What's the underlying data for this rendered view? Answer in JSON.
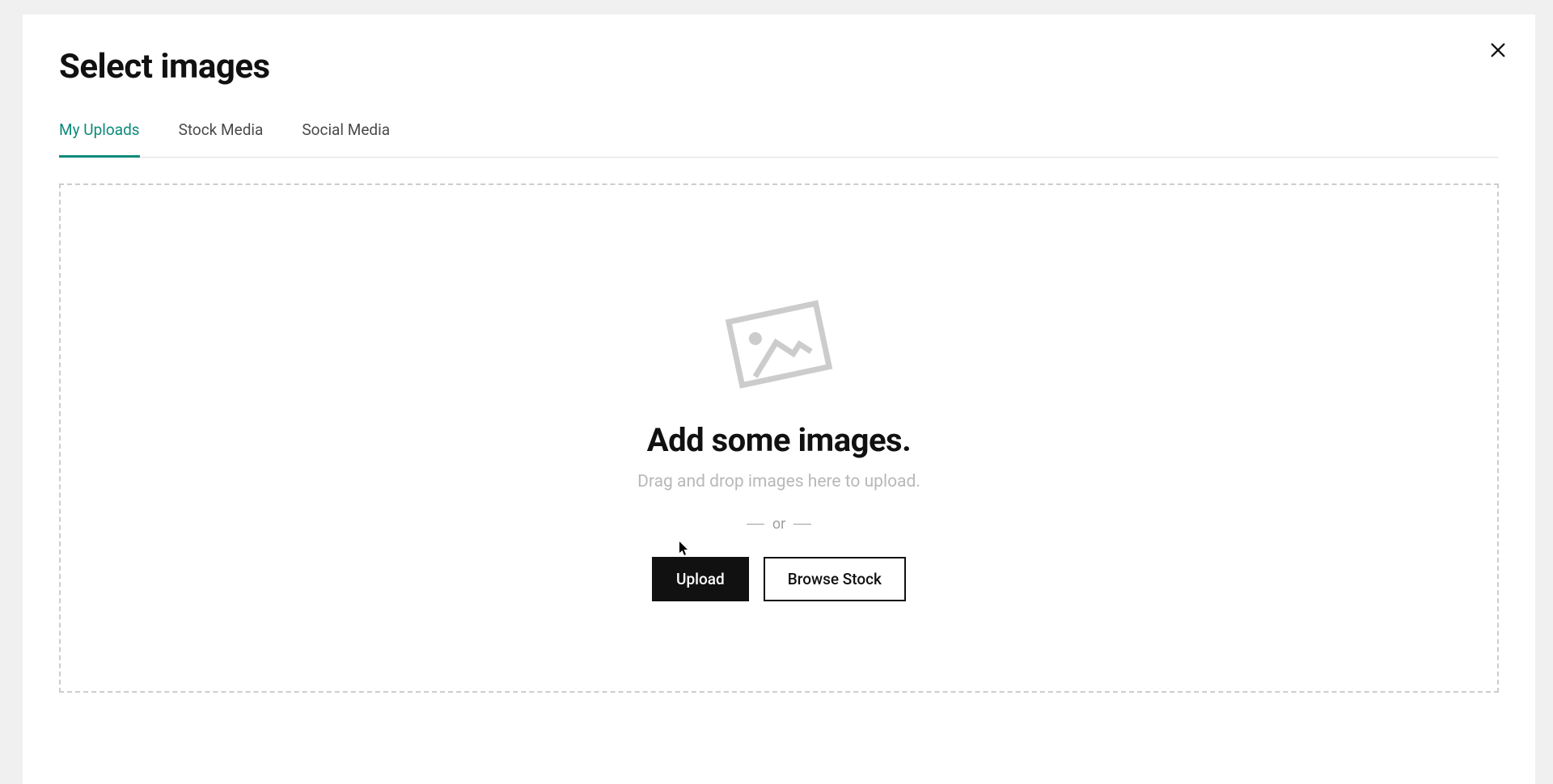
{
  "modal": {
    "title": "Select images",
    "tabs": [
      {
        "label": "My Uploads",
        "active": true
      },
      {
        "label": "Stock Media",
        "active": false
      },
      {
        "label": "Social Media",
        "active": false
      }
    ],
    "dropzone": {
      "heading": "Add some images.",
      "subtext": "Drag and drop images here to upload.",
      "divider": "or",
      "upload_button": "Upload",
      "browse_button": "Browse Stock"
    }
  }
}
